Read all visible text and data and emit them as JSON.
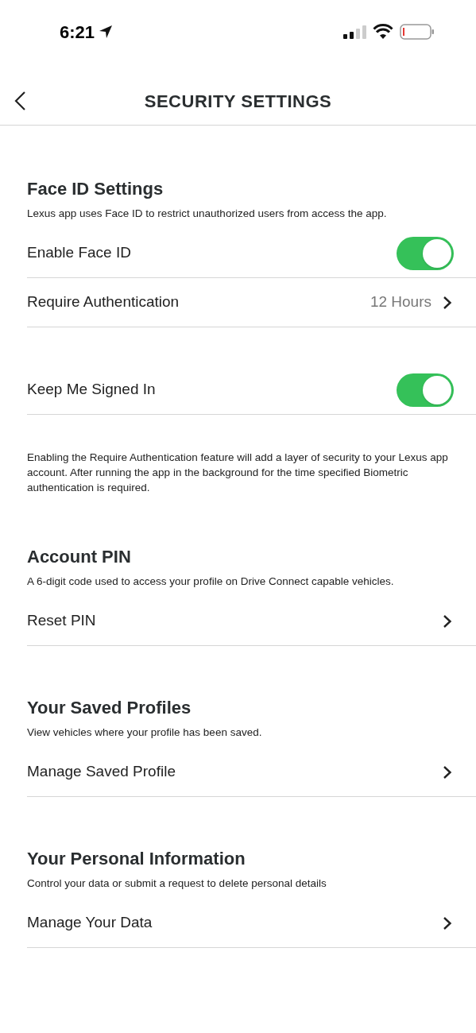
{
  "status_bar": {
    "time": "6:21"
  },
  "header": {
    "title": "SECURITY SETTINGS"
  },
  "sections": [
    {
      "title": "Face ID Settings",
      "description": "Lexus app uses Face ID to restrict unauthorized users from access the app.",
      "groups": [
        {
          "items": [
            {
              "kind": "toggle",
              "label": "Enable Face ID",
              "on": true
            },
            {
              "kind": "link",
              "label": "Require Authentication",
              "value": "12 Hours"
            }
          ]
        },
        {
          "items": [
            {
              "kind": "toggle",
              "label": "Keep Me Signed In",
              "on": true
            }
          ]
        }
      ],
      "note": "Enabling the Require Authentication feature will add a layer of security to your Lexus app account. After running the app in the background for the time specified Biometric authentication is required."
    },
    {
      "title": "Account PIN",
      "description": "A 6-digit code used to access your profile on Drive Connect capable vehicles.",
      "groups": [
        {
          "items": [
            {
              "kind": "link",
              "label": "Reset PIN"
            }
          ]
        }
      ]
    },
    {
      "title": "Your Saved Profiles",
      "description": "View vehicles where your profile has been saved.",
      "groups": [
        {
          "items": [
            {
              "kind": "link",
              "label": "Manage Saved Profile"
            }
          ]
        }
      ]
    },
    {
      "title": "Your Personal Information",
      "description": "Control your data or submit a request to delete personal details",
      "groups": [
        {
          "items": [
            {
              "kind": "link",
              "label": "Manage Your Data"
            }
          ]
        }
      ]
    }
  ]
}
